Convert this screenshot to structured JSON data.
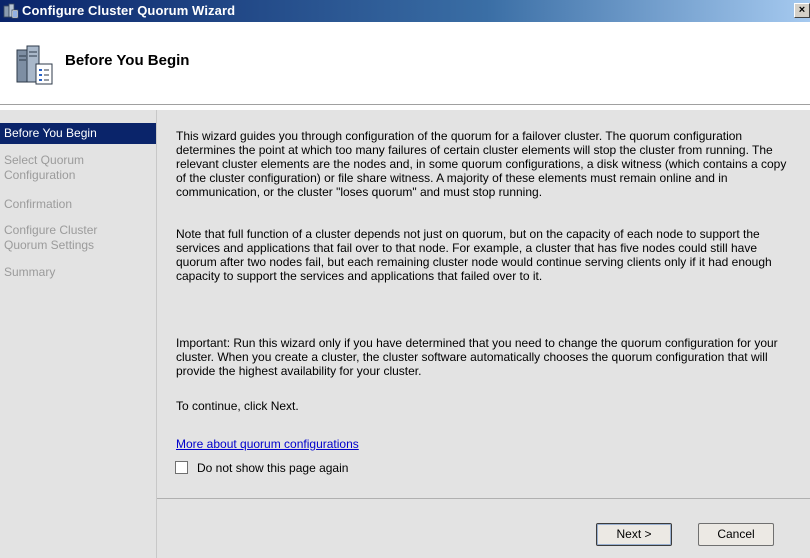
{
  "window": {
    "title": "Configure Cluster Quorum Wizard",
    "close_glyph": "×"
  },
  "header": {
    "title": "Before You Begin",
    "icon": "wizard-servers-icon"
  },
  "steps": [
    {
      "label": "Before You Begin",
      "active": true
    },
    {
      "label": "Select Quorum\nConfiguration",
      "active": false
    },
    {
      "label": "Confirmation",
      "active": false
    },
    {
      "label": "Configure Cluster\nQuorum Settings",
      "active": false
    },
    {
      "label": "Summary",
      "active": false
    }
  ],
  "content": {
    "p1": "This wizard guides you through configuration of the quorum for a failover cluster. The quorum configuration determines the point at which too many failures of certain cluster elements will stop the cluster from running. The relevant cluster elements are the nodes and, in some quorum configurations, a disk witness (which contains a copy of the cluster configuration) or file share witness. A majority of these elements must remain online and in communication, or the cluster \"loses quorum\" and must stop running.",
    "p2": "Note that full function of a cluster depends not just on quorum, but on the capacity of each node to support the services and applications that fail over to that node. For example, a cluster that has five nodes could still have quorum after two nodes fail, but each remaining cluster node would continue serving clients only if it had enough capacity to support the services and applications that failed over to it.",
    "p3": "Important: Run this wizard only if you have determined that you need to change the quorum configuration for your cluster. When you create a cluster, the cluster software automatically chooses the quorum configuration that will provide the highest availability for your cluster.",
    "p4": "To continue, click Next.",
    "link": "More about quorum configurations",
    "checkbox_label": "Do not show this page again",
    "checkbox_checked": false
  },
  "footer": {
    "next_label": "Next >",
    "cancel_label": "Cancel"
  },
  "colors": {
    "titlebar_start": "#0a246a",
    "titlebar_end": "#a6caf0",
    "active_step": "#0a246a",
    "panel_bg": "#e3e3e3",
    "link": "#0000cc"
  }
}
